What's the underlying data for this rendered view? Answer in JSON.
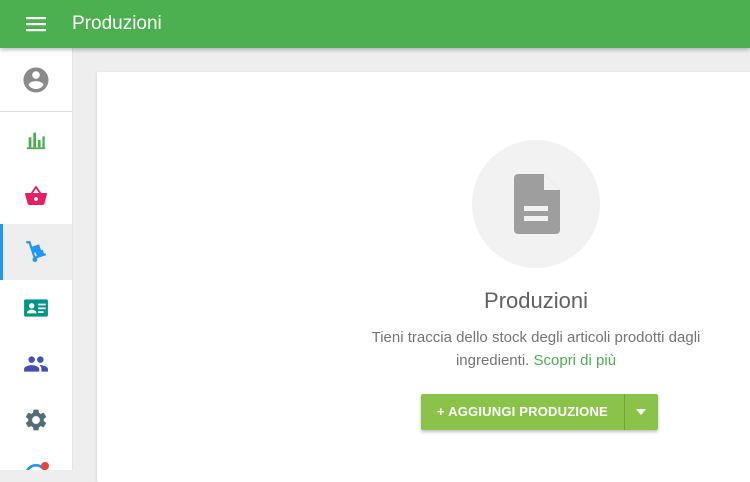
{
  "header": {
    "title": "Produzioni",
    "menu_icon": "menu-icon"
  },
  "sidebar": {
    "items": [
      {
        "icon": "account-circle-icon",
        "color": "#8a8a8a"
      },
      {
        "icon": "bar-chart-icon",
        "color": "#4caf50"
      },
      {
        "icon": "shopping-basket-icon",
        "color": "#e91e63"
      },
      {
        "icon": "hand-truck-icon",
        "color": "#2196f3",
        "active": true
      },
      {
        "icon": "contact-card-icon",
        "color": "#009688"
      },
      {
        "icon": "people-icon",
        "color": "#3f51b5"
      },
      {
        "icon": "gear-icon",
        "color": "#546e7a"
      },
      {
        "icon": "notification-icon",
        "color": "#2196f3"
      }
    ]
  },
  "empty_state": {
    "icon": "document-icon",
    "title": "Produzioni",
    "description": "Tieni traccia dello stock degli articoli prodotti dagli ingredienti.",
    "learn_more": "Scopri di più",
    "add_button": "+ AGGIUNGI PRODUZIONE"
  },
  "colors": {
    "primary": "#4caf50",
    "button": "#8bc34a",
    "active_indicator": "#2196f3"
  }
}
